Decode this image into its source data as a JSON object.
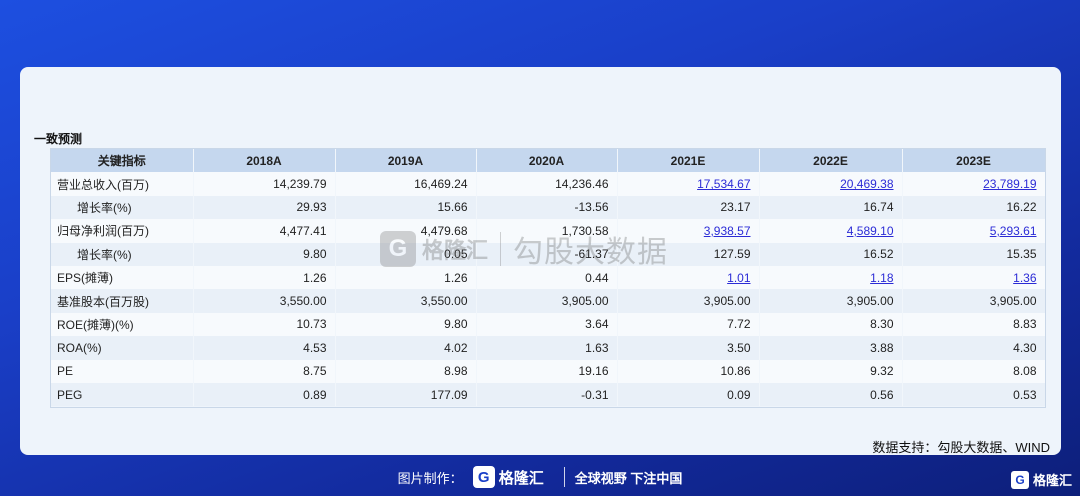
{
  "section_title": "一致预测",
  "table": {
    "headers": [
      "关键指标",
      "2018A",
      "2019A",
      "2020A",
      "2021E",
      "2022E",
      "2023E"
    ],
    "rows": [
      {
        "label": "营业总收入(百万)",
        "indent": false,
        "values": [
          "14,239.79",
          "16,469.24",
          "14,236.46",
          "17,534.67",
          "20,469.38",
          "23,789.19"
        ],
        "links": [
          false,
          false,
          false,
          true,
          true,
          true
        ]
      },
      {
        "label": "增长率(%)",
        "indent": true,
        "values": [
          "29.93",
          "15.66",
          "-13.56",
          "23.17",
          "16.74",
          "16.22"
        ],
        "links": [
          false,
          false,
          false,
          false,
          false,
          false
        ]
      },
      {
        "label": "归母净利润(百万)",
        "indent": false,
        "values": [
          "4,477.41",
          "4,479.68",
          "1,730.58",
          "3,938.57",
          "4,589.10",
          "5,293.61"
        ],
        "links": [
          false,
          false,
          false,
          true,
          true,
          true
        ]
      },
      {
        "label": "增长率(%)",
        "indent": true,
        "values": [
          "9.80",
          "0.05",
          "-61.37",
          "127.59",
          "16.52",
          "15.35"
        ],
        "links": [
          false,
          false,
          false,
          false,
          false,
          false
        ]
      },
      {
        "label": "EPS(摊薄)",
        "indent": false,
        "values": [
          "1.26",
          "1.26",
          "0.44",
          "1.01",
          "1.18",
          "1.36"
        ],
        "links": [
          false,
          false,
          false,
          true,
          true,
          true
        ]
      },
      {
        "label": "基准股本(百万股)",
        "indent": false,
        "values": [
          "3,550.00",
          "3,550.00",
          "3,905.00",
          "3,905.00",
          "3,905.00",
          "3,905.00"
        ],
        "links": [
          false,
          false,
          false,
          false,
          false,
          false
        ]
      },
      {
        "label": "ROE(摊薄)(%)",
        "indent": false,
        "values": [
          "10.73",
          "9.80",
          "3.64",
          "7.72",
          "8.30",
          "8.83"
        ],
        "links": [
          false,
          false,
          false,
          false,
          false,
          false
        ]
      },
      {
        "label": "ROA(%)",
        "indent": false,
        "values": [
          "4.53",
          "4.02",
          "1.63",
          "3.50",
          "3.88",
          "4.30"
        ],
        "links": [
          false,
          false,
          false,
          false,
          false,
          false
        ]
      },
      {
        "label": "PE",
        "indent": false,
        "values": [
          "8.75",
          "8.98",
          "19.16",
          "10.86",
          "9.32",
          "8.08"
        ],
        "links": [
          false,
          false,
          false,
          false,
          false,
          false
        ]
      },
      {
        "label": "PEG",
        "indent": false,
        "values": [
          "0.89",
          "177.09",
          "-0.31",
          "0.09",
          "0.56",
          "0.53"
        ],
        "links": [
          false,
          false,
          false,
          false,
          false,
          false
        ]
      }
    ]
  },
  "source": "数据支持：勾股大数据、WIND",
  "watermark": {
    "icon": "G",
    "brand": "格隆汇",
    "text": "勾股大数据"
  },
  "footer": {
    "made_by": "图片制作：",
    "logo_icon": "G",
    "brand": "格隆汇",
    "slogan": "全球视野 下注中国"
  },
  "corner": {
    "icon": "G",
    "brand": "格隆汇"
  },
  "colors": {
    "background": "#1a3fc8",
    "card": "#eef4fb",
    "header": "#c5d7ee",
    "link": "#2b2bd6"
  }
}
